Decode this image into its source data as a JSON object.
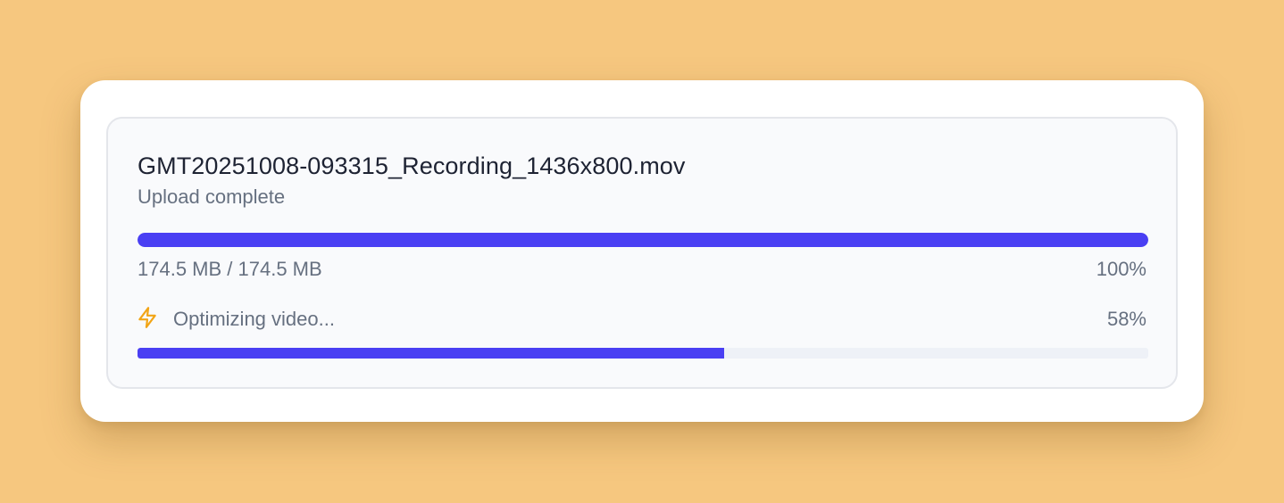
{
  "upload": {
    "file_name": "GMT20251008-093315_Recording_1436x800.mov",
    "status": "Upload complete",
    "size_text": "174.5 MB / 174.5 MB",
    "percent_label": "100%",
    "progress": 1.0
  },
  "optimize": {
    "icon": "lightning-bolt-icon",
    "label": "Optimizing video...",
    "percent_label": "58%",
    "progress": 0.58
  },
  "colors": {
    "background": "#F6C77F",
    "progress_fill": "#4A3FF3",
    "bolt_icon": "#F2A516",
    "text_primary": "#1E2333",
    "text_secondary": "#667080"
  }
}
